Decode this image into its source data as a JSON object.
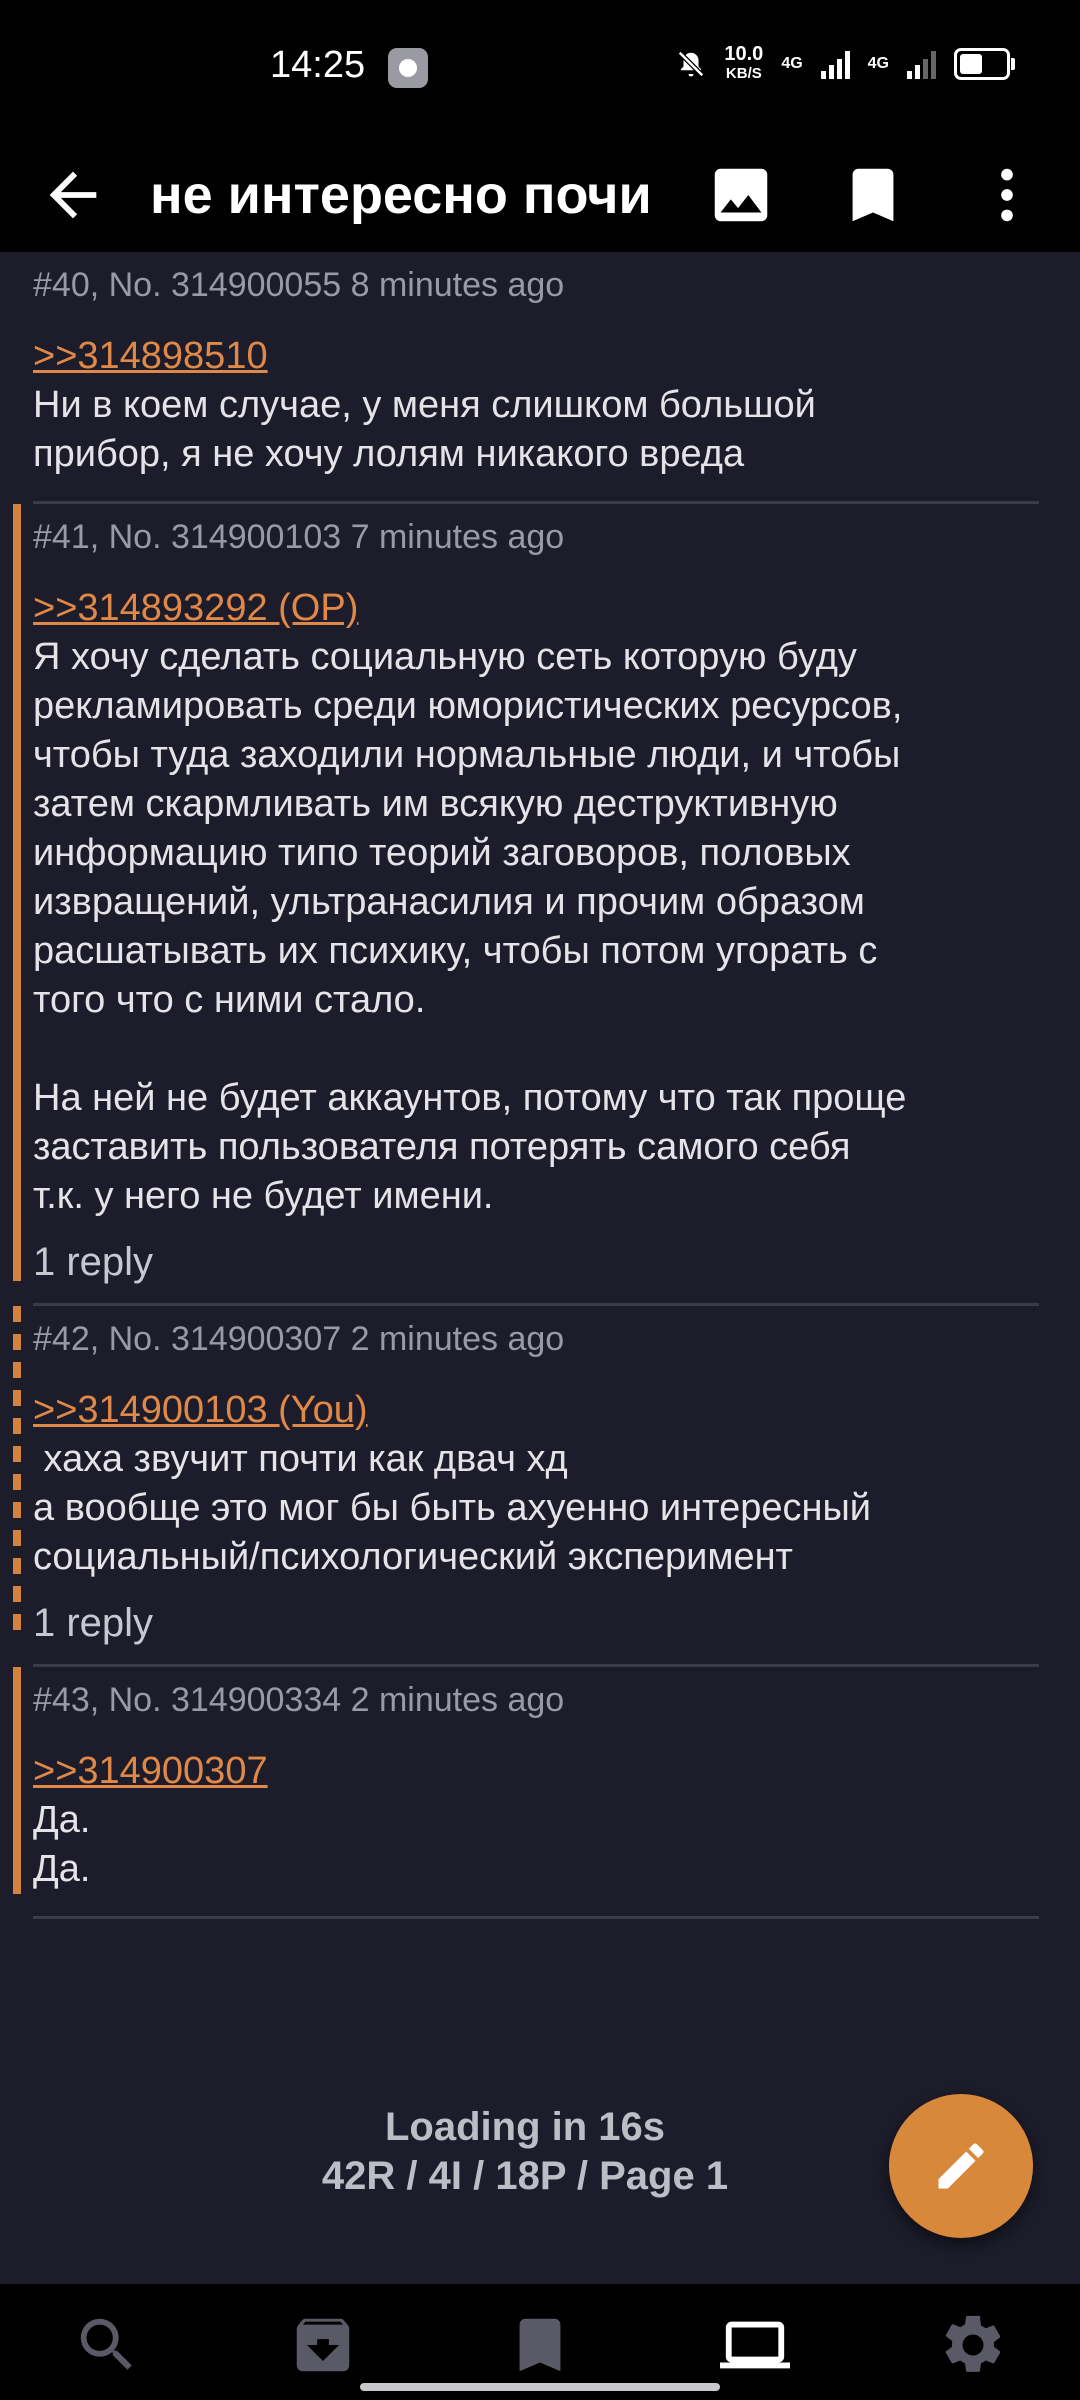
{
  "status_bar": {
    "time": "14:25",
    "speed_value": "10.0",
    "speed_unit": "KB/S",
    "net1": "4G",
    "net2": "4G",
    "icons": [
      "settings-notification-icon",
      "mute-icon",
      "signal-icon",
      "battery-icon"
    ]
  },
  "toolbar": {
    "title": "не интересно почи",
    "icons": [
      "back-arrow-icon",
      "image-icon",
      "bookmark-icon",
      "more-vert-icon"
    ]
  },
  "posts": [
    {
      "header": "#40, No. 314900055 8 minutes ago",
      "quote": ">>314898510",
      "lines": [
        "Ни в коем случае, у меня слишком большой",
        "прибор, я не хочу лолям никакого вреда"
      ],
      "replies": ""
    },
    {
      "header": "#41, No. 314900103 7 minutes ago",
      "quote": ">>314893292 (OP)",
      "lines": [
        "Я хочу сделать социальную сеть которую буду",
        "рекламировать среди юмористических ресурсов,",
        "чтобы туда заходили нормальные люди, и чтобы",
        "затем скармливать им всякую деструктивную",
        "информацию типо теорий заговоров, половых",
        "извращений, ультранасилия и прочим образом",
        "расшатывать их психику, чтобы потом угорать с",
        "того что с ними стало.",
        "",
        "На ней не будет аккаунтов, потому что так проще",
        "заставить пользователя потерять самого себя",
        "т.к. у него не будет имени."
      ],
      "replies": "1 reply"
    },
    {
      "header": "#42, No. 314900307 2 minutes ago",
      "quote": ">>314900103 (You)",
      "lines": [
        " хаха звучит почти как двач хд",
        "а вообще это мог бы быть ахуенно интересный",
        "социальный/психологический эксперимент"
      ],
      "replies": "1 reply"
    },
    {
      "header": "#43, No. 314900334 2 minutes ago",
      "quote": ">>314900307",
      "lines": [
        "Да.",
        "Да."
      ],
      "replies": ""
    }
  ],
  "footer": {
    "loading": "Loading in 16s",
    "stats": "42R / 4I / 18P / Page 1"
  },
  "fab": {
    "icon": "pencil-icon"
  },
  "bottom_nav": [
    "search-icon",
    "archive-icon",
    "bookmark-icon",
    "laptop-icon",
    "settings-icon"
  ],
  "colors": {
    "background": "#1c1c2a",
    "accent": "#d8883a",
    "quote_link": "#e08848",
    "bars": "#000000"
  }
}
